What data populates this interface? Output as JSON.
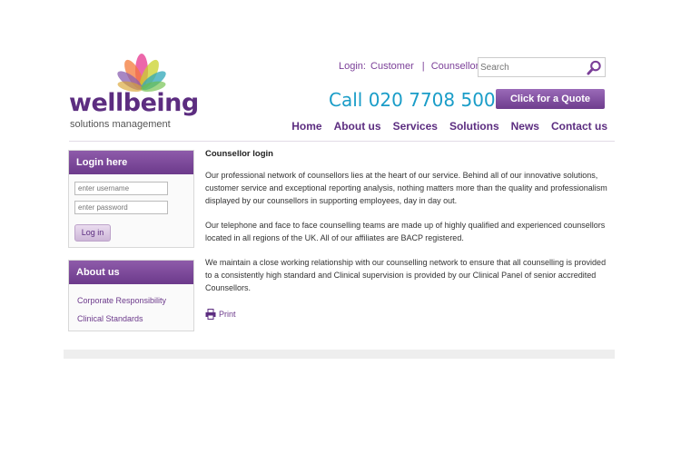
{
  "brand": {
    "name": "wellbeing",
    "tagline": "solutions management",
    "colors": {
      "purple": "#5c2d80",
      "blue": "#1a9dc8"
    }
  },
  "toplinks": {
    "login": "Login:",
    "customer": "Customer",
    "separator": "|",
    "counsellor": "Counsellor"
  },
  "search": {
    "placeholder": "Search",
    "icon": "search-icon"
  },
  "header": {
    "phone": "Call 020 7708 5000",
    "quote_label": "Click for a Quote"
  },
  "nav": {
    "items": [
      "Home",
      "About us",
      "Services",
      "Solutions",
      "News",
      "Contact us"
    ]
  },
  "sidebar": {
    "login": {
      "title": "Login here",
      "username_placeholder": "enter username",
      "password_placeholder": "enter password",
      "button": "Log in"
    },
    "about": {
      "title": "About us",
      "links": [
        "Corporate Responsibility",
        "Clinical Standards"
      ]
    }
  },
  "main": {
    "title": "Counsellor login",
    "paragraphs": [
      "Our professional network of counsellors lies at the heart of our service. Behind all of our innovative solutions, customer service and exceptional reporting analysis, nothing matters more than the quality and professionalism displayed by our counsellors in supporting employees, day in day out.",
      "Our telephone and face to face counselling teams are made up of highly qualified and experienced counsellors located in all regions of the UK. All of our affiliates are BACP registered.",
      "We maintain a close working relationship with our counselling network to ensure that all counselling is provided to a consistently high standard and Clinical supervision is provided by our Clinical Panel of senior accredited Counsellors."
    ],
    "print_label": "Print",
    "print_icon": "printer-icon"
  }
}
